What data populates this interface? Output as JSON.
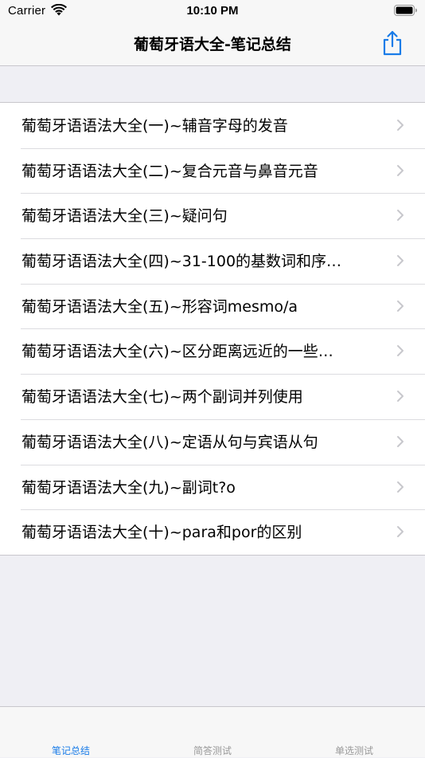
{
  "status_bar": {
    "carrier": "Carrier",
    "time": "10:10 PM"
  },
  "nav": {
    "title": "葡萄牙语大全-笔记总结",
    "share_icon": "share-icon"
  },
  "colors": {
    "accent": "#1a7ce8",
    "background": "#efeff4",
    "separator": "#c8c7cc"
  },
  "list": {
    "items": [
      {
        "label": "葡萄牙语语法大全(一)~辅音字母的发音"
      },
      {
        "label": "葡萄牙语语法大全(二)~复合元音与鼻音元音"
      },
      {
        "label": "葡萄牙语语法大全(三)~疑问句"
      },
      {
        "label": "葡萄牙语语法大全(四)~31-100的基数词和序…"
      },
      {
        "label": "葡萄牙语语法大全(五)~形容词mesmo/a"
      },
      {
        "label": "葡萄牙语语法大全(六)~区分距离远近的一些…"
      },
      {
        "label": "葡萄牙语语法大全(七)~两个副词并列使用"
      },
      {
        "label": "葡萄牙语语法大全(八)~定语从句与宾语从句"
      },
      {
        "label": "葡萄牙语语法大全(九)~副词t?o"
      },
      {
        "label": "葡萄牙语语法大全(十)~para和por的区别"
      }
    ]
  },
  "tabs": [
    {
      "label": "笔记总结",
      "active": true
    },
    {
      "label": "简答测试",
      "active": false
    },
    {
      "label": "单选测试",
      "active": false
    }
  ]
}
